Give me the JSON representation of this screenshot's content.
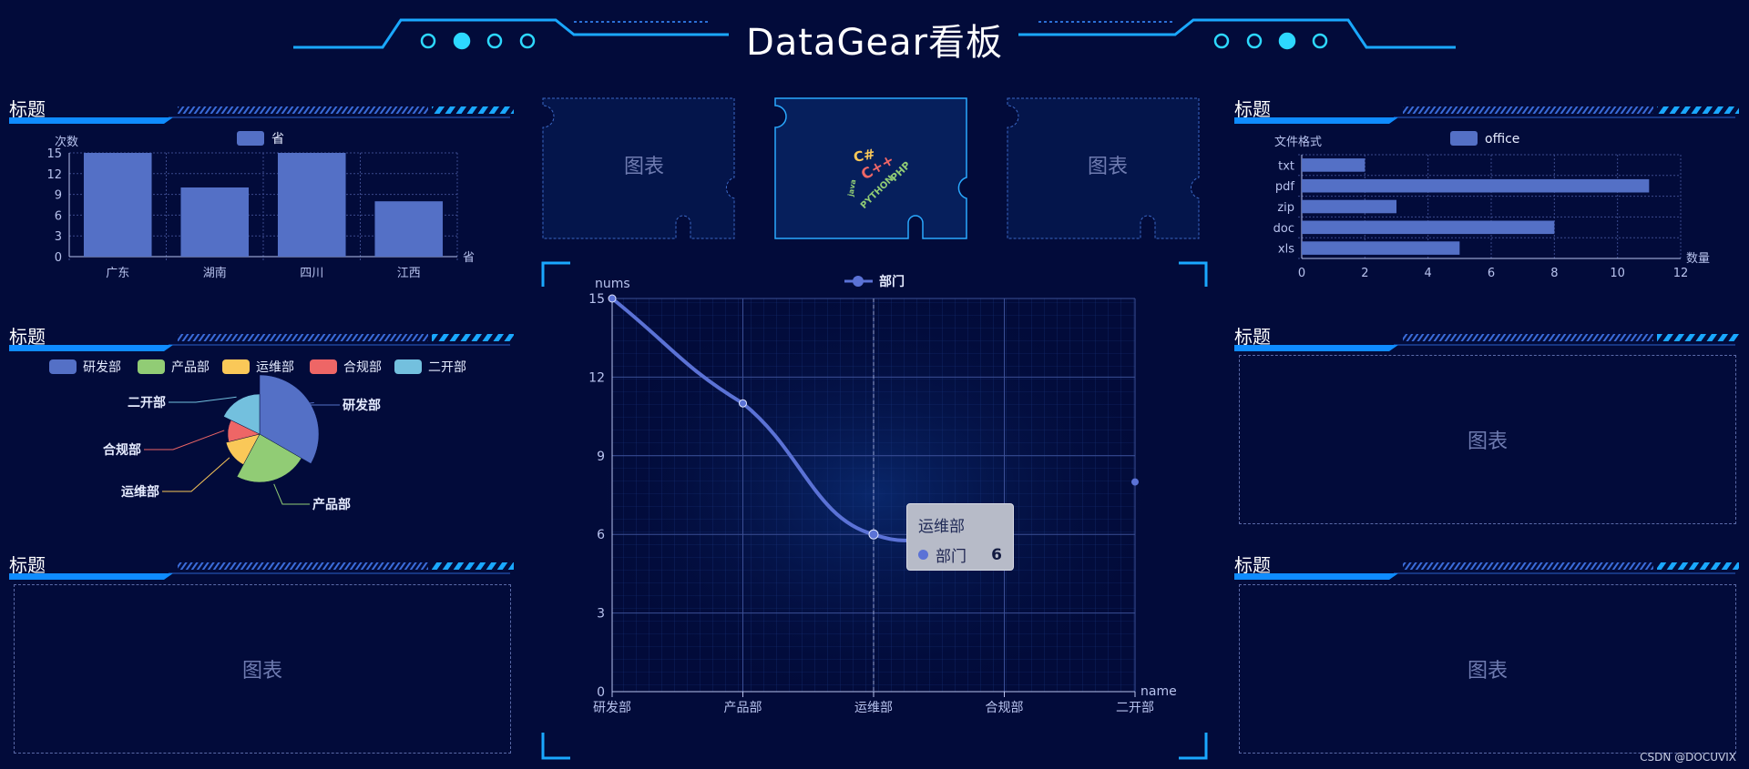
{
  "header": {
    "title": "DataGear看板"
  },
  "panels": {
    "left_top": {
      "title": "标题",
      "chart": {
        "type": "bar",
        "legend": "省",
        "ylabel": "次数",
        "xlabel": "省",
        "categories": [
          "广东",
          "湖南",
          "四川",
          "江西"
        ],
        "values": [
          15,
          10,
          15,
          8
        ],
        "ylim": [
          0,
          15
        ],
        "yticks": [
          "15",
          "12",
          "9",
          "6",
          "3",
          "0"
        ],
        "color": "#5470c6"
      }
    },
    "left_mid": {
      "title": "标题",
      "chart": {
        "type": "pie",
        "legend": [
          "研发部",
          "产品部",
          "运维部",
          "合规部",
          "二开部"
        ],
        "labels": [
          "研发部",
          "产品部",
          "运维部",
          "合规部",
          "二开部"
        ],
        "values": [
          15,
          11,
          6,
          5,
          8
        ],
        "colors": [
          "#5470c6",
          "#91cc75",
          "#fac858",
          "#ee6666",
          "#73c0de"
        ]
      }
    },
    "left_bottom": {
      "title": "标题",
      "placeholder": "图表"
    },
    "center_top": {
      "left_placeholder": "图表",
      "right_placeholder": "图表",
      "cloud_words": [
        "C#",
        "C++",
        "java",
        "PYTHON",
        "PHP"
      ]
    },
    "center_main": {
      "chart": {
        "type": "line",
        "legend": "部门",
        "ylabel": "nums",
        "xlabel": "name",
        "categories": [
          "研发部",
          "产品部",
          "运维部",
          "合规部",
          "二开部"
        ],
        "values": [
          15,
          11,
          6,
          7,
          8
        ],
        "ylim": [
          0,
          15
        ],
        "yticks": [
          "15",
          "12",
          "9",
          "6",
          "3",
          "0"
        ],
        "color": "#5b72d6"
      },
      "tooltip": {
        "title": "运维部",
        "series": "部门",
        "value": "6"
      }
    },
    "right_top": {
      "title": "标题",
      "chart": {
        "type": "bar",
        "legend": "office",
        "ylabel": "文件格式",
        "xlabel": "数量",
        "categories": [
          "txt",
          "pdf",
          "zip",
          "doc",
          "xls"
        ],
        "values": [
          2,
          11,
          3,
          8,
          5
        ],
        "xlim": [
          0,
          12
        ],
        "xticks": [
          "0",
          "2",
          "4",
          "6",
          "8",
          "10",
          "12"
        ],
        "color": "#5470c6"
      }
    },
    "right_mid": {
      "title": "标题",
      "placeholder": "图表"
    },
    "right_bottom": {
      "title": "标题",
      "placeholder": "图表"
    }
  },
  "watermark": "CSDN @DOCUVIX"
}
